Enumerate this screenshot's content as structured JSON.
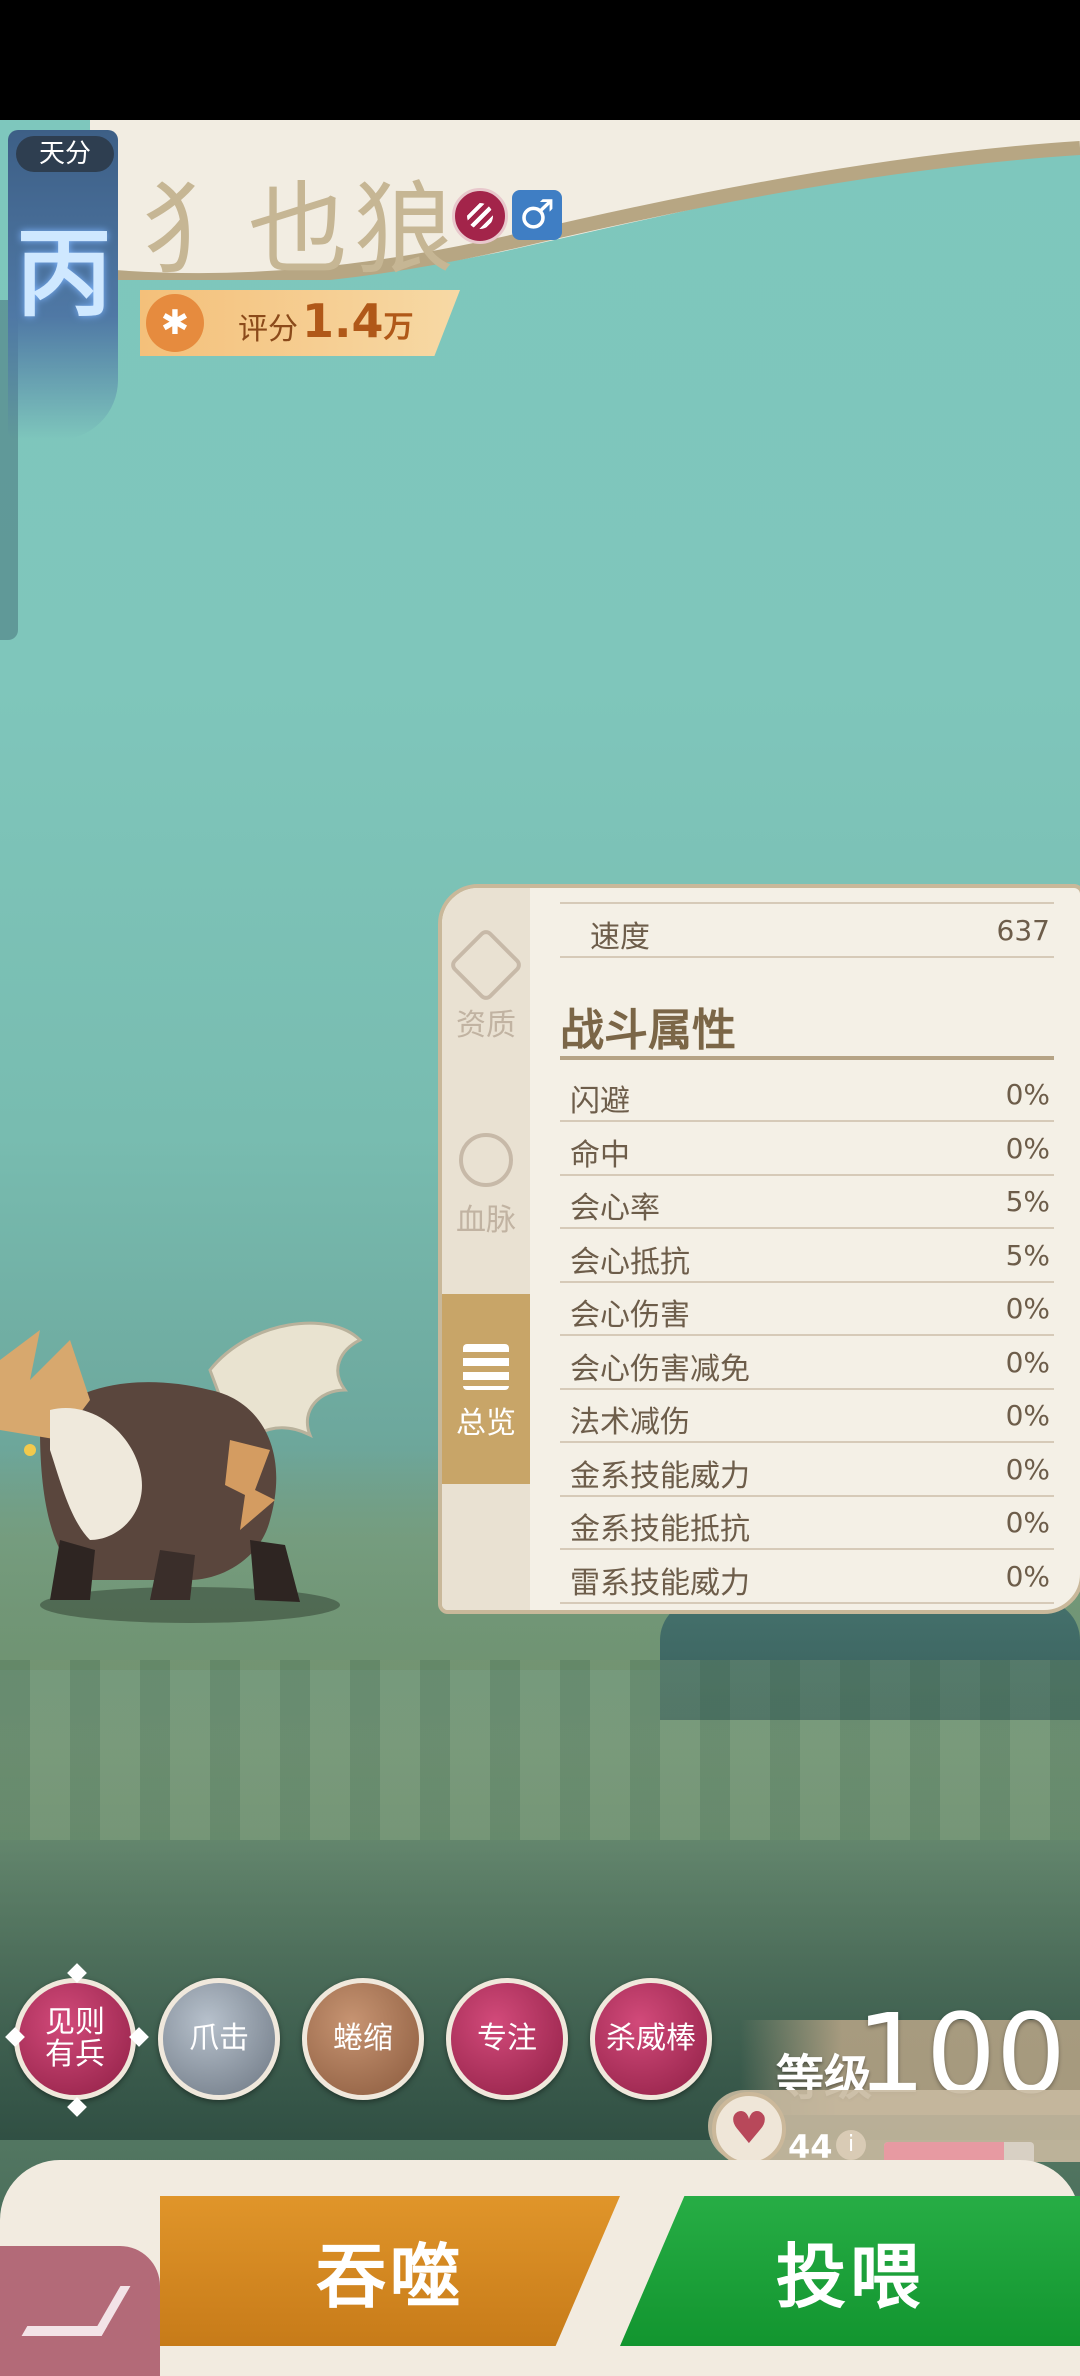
{
  "header": {
    "tier_label": "天分",
    "tier_value": "丙",
    "pet_name": "犭也狼",
    "gender_symbol": "♂",
    "score_label": "评分",
    "score_value": "1.4",
    "score_unit": "万",
    "icons": [
      "type-icon",
      "gender-male-icon",
      "paw-icon"
    ]
  },
  "panel": {
    "tabs": [
      {
        "label": "资质",
        "icon": "hexagon-icon",
        "active": false
      },
      {
        "label": "血脉",
        "icon": "bloodline-icon",
        "active": false
      },
      {
        "label": "总览",
        "icon": "list-icon",
        "active": true
      }
    ],
    "top_row": {
      "name": "速度",
      "value": "637"
    },
    "section_title": "战斗属性",
    "stats": [
      {
        "name": "闪避",
        "value": "0%"
      },
      {
        "name": "命中",
        "value": "0%"
      },
      {
        "name": "会心率",
        "value": "5%"
      },
      {
        "name": "会心抵抗",
        "value": "5%"
      },
      {
        "name": "会心伤害",
        "value": "0%"
      },
      {
        "name": "会心伤害减免",
        "value": "0%"
      },
      {
        "name": "法术减伤",
        "value": "0%"
      },
      {
        "name": "金系技能威力",
        "value": "0%"
      },
      {
        "name": "金系技能抵抗",
        "value": "0%"
      },
      {
        "name": "雷系技能威力",
        "value": "0%"
      }
    ]
  },
  "skills": [
    {
      "line1": "见则",
      "line2": "有兵",
      "style": "red",
      "selected": true
    },
    {
      "line1": "爪击",
      "line2": "",
      "style": "gray",
      "selected": false
    },
    {
      "line1": "蜷缩",
      "line2": "",
      "style": "brown",
      "selected": false
    },
    {
      "line1": "专注",
      "line2": "",
      "style": "red",
      "selected": false
    },
    {
      "line1": "杀威棒",
      "line2": "",
      "style": "red",
      "selected": false
    }
  ],
  "level": {
    "label": "等级",
    "value": "100",
    "hp_value": "44",
    "hp_fraction": 0.8
  },
  "actions": {
    "devour_label": "吞噬",
    "feed_label": "投喂"
  },
  "colors": {
    "devour": "#d08520",
    "feed": "#1ea23b",
    "accent": "#c8a568"
  }
}
